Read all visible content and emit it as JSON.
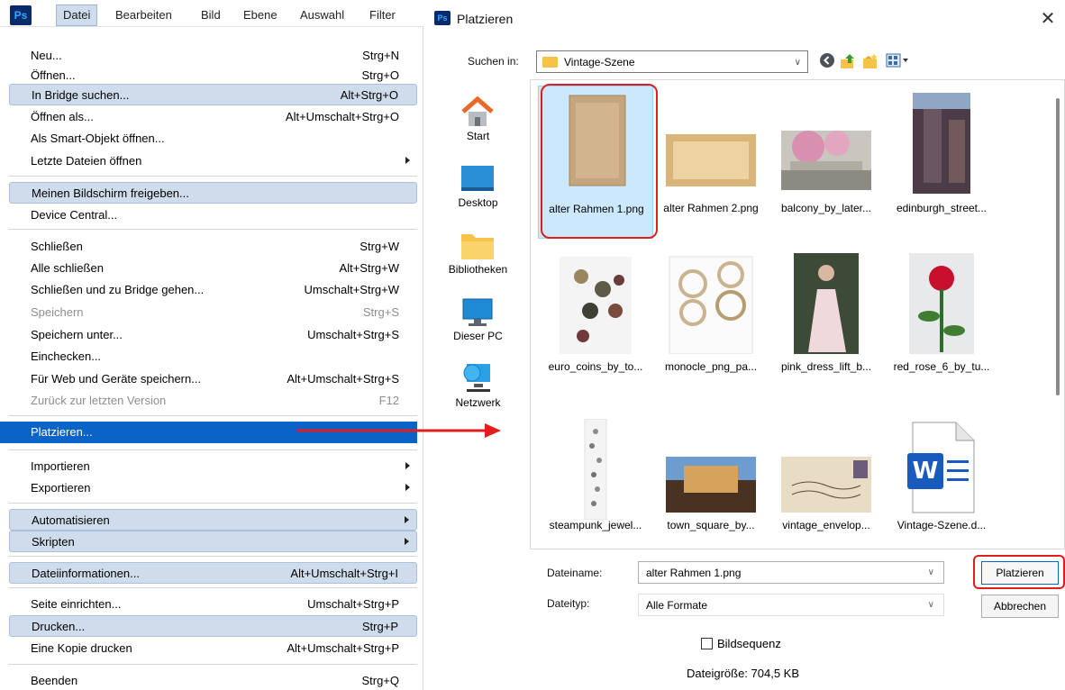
{
  "menubar": {
    "logo": "Ps",
    "items": [
      "Datei",
      "Bearbeiten",
      "Bild",
      "Ebene",
      "Auswahl",
      "Filter"
    ]
  },
  "file_menu": [
    {
      "label": "Neu...",
      "shortcut": "Strg+N"
    },
    {
      "label": "Öffnen...",
      "shortcut": "Strg+O"
    },
    {
      "label": "In Bridge suchen...",
      "shortcut": "Alt+Strg+O"
    },
    {
      "label": "Öffnen als...",
      "shortcut": "Alt+Umschalt+Strg+O"
    },
    {
      "label": "Als Smart-Objekt öffnen...",
      "shortcut": ""
    },
    {
      "label": "Letzte Dateien öffnen",
      "shortcut": ""
    },
    {
      "label": "Meinen Bildschirm freigeben...",
      "shortcut": ""
    },
    {
      "label": "Device Central...",
      "shortcut": ""
    },
    {
      "label": "Schließen",
      "shortcut": "Strg+W"
    },
    {
      "label": "Alle schließen",
      "shortcut": "Alt+Strg+W"
    },
    {
      "label": "Schließen und zu Bridge gehen...",
      "shortcut": "Umschalt+Strg+W"
    },
    {
      "label": "Speichern",
      "shortcut": "Strg+S"
    },
    {
      "label": "Speichern unter...",
      "shortcut": "Umschalt+Strg+S"
    },
    {
      "label": "Einchecken...",
      "shortcut": ""
    },
    {
      "label": "Für Web und Geräte speichern...",
      "shortcut": "Alt+Umschalt+Strg+S"
    },
    {
      "label": "Zurück zur letzten Version",
      "shortcut": "F12"
    },
    {
      "label": "Platzieren...",
      "shortcut": ""
    },
    {
      "label": "Importieren",
      "shortcut": ""
    },
    {
      "label": "Exportieren",
      "shortcut": ""
    },
    {
      "label": "Automatisieren",
      "shortcut": ""
    },
    {
      "label": "Skripten",
      "shortcut": ""
    },
    {
      "label": "Dateiinformationen...",
      "shortcut": "Alt+Umschalt+Strg+I"
    },
    {
      "label": "Seite einrichten...",
      "shortcut": "Umschalt+Strg+P"
    },
    {
      "label": "Drucken...",
      "shortcut": "Strg+P"
    },
    {
      "label": "Eine Kopie drucken",
      "shortcut": "Alt+Umschalt+Strg+P"
    },
    {
      "label": "Beenden",
      "shortcut": "Strg+Q"
    }
  ],
  "dialog": {
    "logo": "Ps",
    "title": "Platzieren",
    "close": "✕",
    "look_in_label": "Suchen in:",
    "look_in_value": "Vintage-Szene",
    "places": [
      "Start",
      "Desktop",
      "Bibliotheken",
      "Dieser PC",
      "Netzwerk"
    ],
    "files": [
      "alter Rahmen 1.png",
      "alter Rahmen 2.png",
      "balcony_by_later...",
      "edinburgh_street...",
      "euro_coins_by_to...",
      "monocle_png_pa...",
      "pink_dress_lift_b...",
      "red_rose_6_by_tu...",
      "steampunk_jewel...",
      "town_square_by...",
      "vintage_envelop...",
      "Vintage-Szene.d..."
    ],
    "filename_label": "Dateiname:",
    "filename_value": "alter Rahmen 1.png",
    "filetype_label": "Dateityp:",
    "filetype_value": "Alle Formate",
    "place_button": "Platzieren",
    "cancel_button": "Abbrechen",
    "image_sequence": "Bildsequenz",
    "file_size": "Dateigröße: 704,5 KB"
  },
  "colors": {
    "menu_highlight": "#cfdcec",
    "menu_selected": "#0a64c8",
    "annotation_red": "#e01e1e",
    "grid_selection": "#cce8ff"
  }
}
